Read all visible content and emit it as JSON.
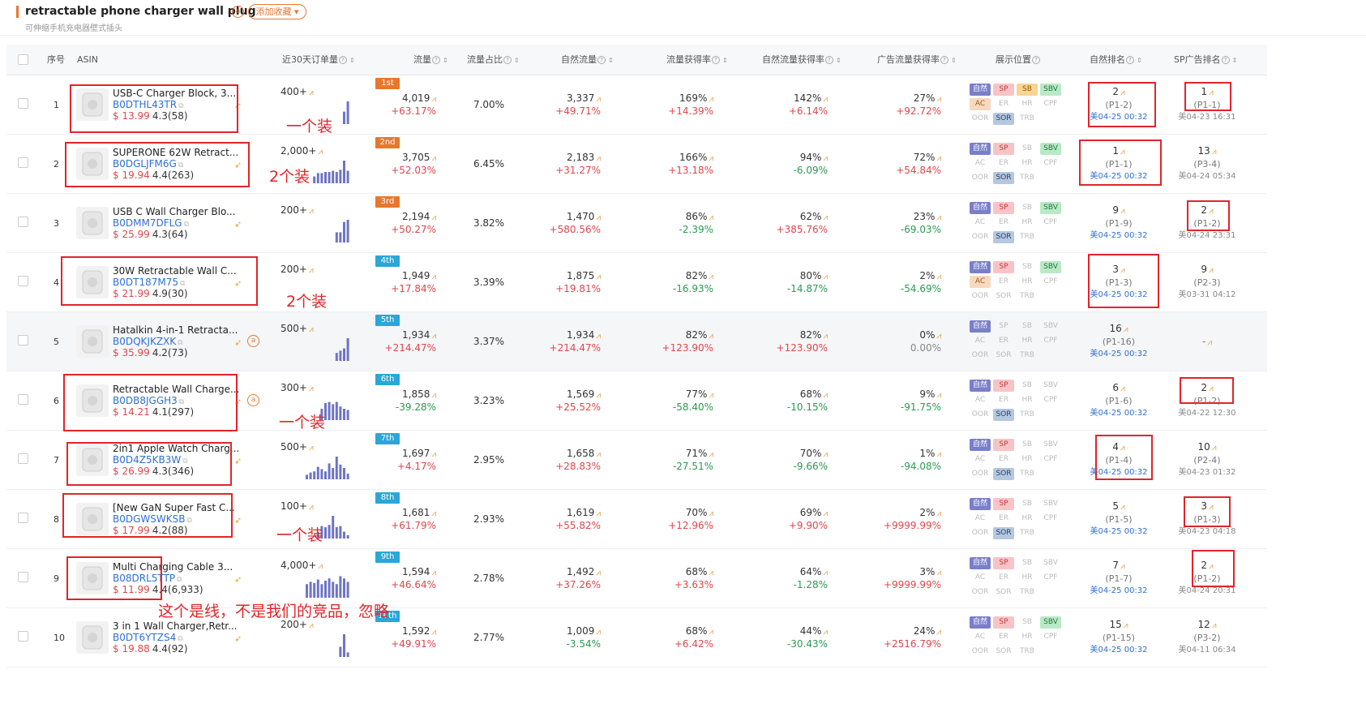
{
  "header": {
    "keyword": "retractable phone charger wall plug",
    "badge": "a",
    "add_favorite": "添加收藏 ▾",
    "translation": "可伸缩手机充电器壁式插头"
  },
  "columns": {
    "index": "序号",
    "asin": "ASIN",
    "sales30": "近30天订单量",
    "traffic": "流量",
    "traffic_share": "流量占比",
    "organic_traffic": "自然流量",
    "traffic_capture": "流量获得率",
    "organic_capture": "自然流量获得率",
    "ad_capture": "广告流量获得率",
    "placement": "展示位置",
    "organic_rank": "自然排名",
    "sp_rank": "SP广告排名"
  },
  "tag_labels": [
    "自然",
    "SP",
    "SB",
    "SBV",
    "AC",
    "ER",
    "HR",
    "CPF",
    "OOR",
    "SOR",
    "TRB"
  ],
  "colors": {
    "accent": "#e8772e",
    "red": "#e2242a",
    "up": "#e0464b",
    "down": "#2a9a52",
    "link": "#2f6fd6",
    "spark": "#6e74c4"
  },
  "rows": [
    {
      "idx": "1",
      "title": "USB-C Charger Block, 3...",
      "asin": "B0DTHL43TR",
      "price": "$ 13.99",
      "rating": "4.3(58)",
      "sales": "400+",
      "rank_badge": "1st",
      "rank_color": "#e8772e",
      "traffic": "4,019",
      "traffic_g": "+63.17%",
      "share": "7.00%",
      "organic": "3,337",
      "organic_g": "+49.71%",
      "cap": "169%",
      "cap_g": "+14.39%",
      "ocap": "142%",
      "ocap_g": "+6.14%",
      "acap": "27%",
      "acap_g": "+92.72%",
      "tags": [
        "natural",
        "sp",
        "sb",
        "sbv",
        "ac",
        "",
        "",
        "",
        "",
        "sor",
        ""
      ],
      "nat_rank": "2",
      "nat_pos": "(P1-2)",
      "nat_time": "美04-25 00:32",
      "sp_rank": "1",
      "sp_pos": "(P1-1)",
      "sp_time": "美04-23 16:31",
      "has_a": false,
      "spark": [
        0,
        0,
        0,
        0,
        0,
        0,
        0,
        0,
        0,
        0,
        0.55,
        1.0
      ]
    },
    {
      "idx": "2",
      "title": "SUPERONE 62W Retract...",
      "asin": "B0DGLJFM6G",
      "price": "$ 19.94",
      "rating": "4.4(263)",
      "sales": "2,000+",
      "rank_badge": "2nd",
      "rank_color": "#e8772e",
      "traffic": "3,705",
      "traffic_g": "+52.03%",
      "share": "6.45%",
      "organic": "2,183",
      "organic_g": "+31.27%",
      "cap": "166%",
      "cap_g": "+13.18%",
      "ocap": "94%",
      "ocap_g": "-6.09%",
      "acap": "72%",
      "acap_g": "+54.84%",
      "tags": [
        "natural",
        "sp",
        "",
        "sbv",
        "",
        "",
        "",
        "",
        "",
        "sor",
        ""
      ],
      "nat_rank": "1",
      "nat_pos": "(P1-1)",
      "nat_time": "美04-25 00:32",
      "sp_rank": "13",
      "sp_pos": "(P3-4)",
      "sp_time": "美04-24 05:34",
      "has_a": false,
      "spark": [
        0,
        0,
        0.3,
        0.45,
        0.45,
        0.5,
        0.5,
        0.55,
        0.5,
        0.6,
        1.0,
        0.55
      ]
    },
    {
      "idx": "3",
      "title": "USB C Wall Charger Blo...",
      "asin": "B0DMM7DFLG",
      "price": "$ 25.99",
      "rating": "4.3(64)",
      "sales": "200+",
      "rank_badge": "3rd",
      "rank_color": "#e8772e",
      "traffic": "2,194",
      "traffic_g": "+50.27%",
      "share": "3.82%",
      "organic": "1,470",
      "organic_g": "+580.56%",
      "cap": "86%",
      "cap_g": "-2.39%",
      "ocap": "62%",
      "ocap_g": "+385.76%",
      "acap": "23%",
      "acap_g": "-69.03%",
      "tags": [
        "natural",
        "sp",
        "",
        "sbv",
        "",
        "",
        "",
        "",
        "",
        "sor",
        ""
      ],
      "nat_rank": "9",
      "nat_pos": "(P1-9)",
      "nat_time": "美04-25 00:32",
      "sp_rank": "2",
      "sp_pos": "(P1-2)",
      "sp_time": "美04-24 23:31",
      "has_a": false,
      "spark": [
        0,
        0,
        0,
        0,
        0,
        0,
        0,
        0,
        0.45,
        0.45,
        0.9,
        1.0
      ]
    },
    {
      "idx": "4",
      "title": "30W Retractable Wall C...",
      "asin": "B0DT187M75",
      "price": "$ 21.99",
      "rating": "4.9(30)",
      "sales": "200+",
      "rank_badge": "4th",
      "rank_color": "#2aa7d8",
      "traffic": "1,949",
      "traffic_g": "+17.84%",
      "share": "3.39%",
      "organic": "1,875",
      "organic_g": "+19.81%",
      "cap": "82%",
      "cap_g": "-16.93%",
      "ocap": "80%",
      "ocap_g": "-14.87%",
      "acap": "2%",
      "acap_g": "-54.69%",
      "tags": [
        "natural",
        "sp",
        "",
        "sbv",
        "ac",
        "",
        "",
        "",
        "",
        "",
        ""
      ],
      "nat_rank": "3",
      "nat_pos": "(P1-3)",
      "nat_time": "美04-25 00:32",
      "sp_rank": "9",
      "sp_pos": "(P2-3)",
      "sp_time": "美03-31 04:12",
      "has_a": false,
      "spark": []
    },
    {
      "idx": "5",
      "title": "Hatalkin 4-in-1 Retracta...",
      "asin": "B0DQKJKZXK",
      "price": "$ 35.99",
      "rating": "4.2(73)",
      "sales": "500+",
      "rank_badge": "5th",
      "rank_color": "#2aa7d8",
      "traffic": "1,934",
      "traffic_g": "+214.47%",
      "share": "3.37%",
      "organic": "1,934",
      "organic_g": "+214.47%",
      "cap": "82%",
      "cap_g": "+123.90%",
      "ocap": "82%",
      "ocap_g": "+123.90%",
      "acap": "0%",
      "acap_g": "0.00%",
      "tags": [
        "natural",
        "",
        "",
        "",
        "",
        "",
        "",
        "",
        "",
        "",
        ""
      ],
      "nat_rank": "16",
      "nat_pos": "(P1-16)",
      "nat_time": "美04-25 00:32",
      "sp_rank": "-",
      "sp_pos": "",
      "sp_time": "",
      "has_a": true,
      "spark": [
        0,
        0,
        0,
        0,
        0,
        0,
        0,
        0,
        0.35,
        0.45,
        0.55,
        1.0
      ]
    },
    {
      "idx": "6",
      "title": "Retractable Wall Charge...",
      "asin": "B0DB8JGGH3",
      "price": "$ 14.21",
      "rating": "4.1(297)",
      "sales": "300+",
      "rank_badge": "6th",
      "rank_color": "#2aa7d8",
      "traffic": "1,858",
      "traffic_g": "-39.28%",
      "share": "3.23%",
      "organic": "1,569",
      "organic_g": "+25.52%",
      "cap": "77%",
      "cap_g": "-58.40%",
      "ocap": "68%",
      "ocap_g": "-10.15%",
      "acap": "9%",
      "acap_g": "-91.75%",
      "tags": [
        "natural",
        "sp",
        "",
        "",
        "",
        "",
        "",
        "",
        "",
        "sor",
        ""
      ],
      "nat_rank": "6",
      "nat_pos": "(P1-6)",
      "nat_time": "美04-25 00:32",
      "sp_rank": "2",
      "sp_pos": "(P1-2)",
      "sp_time": "美04-22 12:30",
      "has_a": true,
      "spark": [
        0,
        0,
        0,
        0,
        0.5,
        0.75,
        0.8,
        0.7,
        0.8,
        0.6,
        0.5,
        0.45
      ]
    },
    {
      "idx": "7",
      "title": "2in1 Apple Watch Charg...",
      "asin": "B0D4Z5KB3W",
      "price": "$ 26.99",
      "rating": "4.3(346)",
      "sales": "500+",
      "rank_badge": "7th",
      "rank_color": "#2aa7d8",
      "traffic": "1,697",
      "traffic_g": "+4.17%",
      "share": "2.95%",
      "organic": "1,658",
      "organic_g": "+28.83%",
      "cap": "71%",
      "cap_g": "-27.51%",
      "ocap": "70%",
      "ocap_g": "-9.66%",
      "acap": "1%",
      "acap_g": "-94.08%",
      "tags": [
        "natural",
        "sp",
        "",
        "",
        "",
        "",
        "",
        "",
        "",
        "sor",
        ""
      ],
      "nat_rank": "4",
      "nat_pos": "(P1-4)",
      "nat_time": "美04-25 00:32",
      "sp_rank": "10",
      "sp_pos": "(P2-4)",
      "sp_time": "美04-23 01:32",
      "has_a": false,
      "spark": [
        0.2,
        0.3,
        0.35,
        0.55,
        0.45,
        0.35,
        0.7,
        0.5,
        1.0,
        0.65,
        0.5,
        0.25
      ]
    },
    {
      "idx": "8",
      "title": "[New GaN Super Fast C...",
      "asin": "B0DGWSWKSB",
      "price": "$ 17.99",
      "rating": "4.2(88)",
      "sales": "100+",
      "rank_badge": "8th",
      "rank_color": "#2aa7d8",
      "traffic": "1,681",
      "traffic_g": "+61.79%",
      "share": "2.93%",
      "organic": "1,619",
      "organic_g": "+55.82%",
      "cap": "70%",
      "cap_g": "+12.96%",
      "ocap": "69%",
      "ocap_g": "+9.90%",
      "acap": "2%",
      "acap_g": "+9999.99%",
      "tags": [
        "natural",
        "sp",
        "",
        "",
        "",
        "",
        "",
        "",
        "",
        "sor",
        ""
      ],
      "nat_rank": "5",
      "nat_pos": "(P1-5)",
      "nat_time": "美04-25 00:32",
      "sp_rank": "3",
      "sp_pos": "(P1-3)",
      "sp_time": "美04-23 04:18",
      "has_a": false,
      "spark": [
        0,
        0,
        0,
        0.3,
        0.55,
        0.5,
        0.6,
        1.0,
        0.5,
        0.55,
        0.3,
        0.15
      ]
    },
    {
      "idx": "9",
      "title": "Multi Charging Cable 3...",
      "asin": "B08DRL5TTP",
      "price": "$ 11.99",
      "rating": "4.4(6,933)",
      "sales": "4,000+",
      "rank_badge": "9th",
      "rank_color": "#2aa7d8",
      "traffic": "1,594",
      "traffic_g": "+46.64%",
      "share": "2.78%",
      "organic": "1,492",
      "organic_g": "+37.26%",
      "cap": "68%",
      "cap_g": "+3.63%",
      "ocap": "64%",
      "ocap_g": "-1.28%",
      "acap": "3%",
      "acap_g": "+9999.99%",
      "tags": [
        "natural",
        "sp",
        "",
        "",
        "",
        "",
        "",
        "",
        "",
        "",
        ""
      ],
      "nat_rank": "7",
      "nat_pos": "(P1-7)",
      "nat_time": "美04-25 00:32",
      "sp_rank": "2",
      "sp_pos": "(P1-2)",
      "sp_time": "美04-24 20:31",
      "has_a": false,
      "spark": [
        0.6,
        0.7,
        0.65,
        0.8,
        0.6,
        0.75,
        0.85,
        0.7,
        0.6,
        0.95,
        0.85,
        0.7
      ]
    },
    {
      "idx": "10",
      "title": "3 in 1 Wall Charger,Retr...",
      "asin": "B0DT6YTZS4",
      "price": "$ 19.88",
      "rating": "4.4(92)",
      "sales": "200+",
      "rank_badge": "10th",
      "rank_color": "#2aa7d8",
      "traffic": "1,592",
      "traffic_g": "+49.91%",
      "share": "2.77%",
      "organic": "1,009",
      "organic_g": "-3.54%",
      "cap": "68%",
      "cap_g": "+6.42%",
      "ocap": "44%",
      "ocap_g": "-30.43%",
      "acap": "24%",
      "acap_g": "+2516.79%",
      "tags": [
        "natural",
        "sp",
        "",
        "sbv",
        "",
        "",
        "",
        "",
        "",
        "",
        ""
      ],
      "nat_rank": "15",
      "nat_pos": "(P1-15)",
      "nat_time": "美04-25 00:32",
      "sp_rank": "12",
      "sp_pos": "(P3-2)",
      "sp_time": "美04-11 06:34",
      "has_a": false,
      "spark": [
        0,
        0,
        0,
        0,
        0,
        0,
        0,
        0,
        0,
        0.45,
        1.0,
        0.2
      ]
    }
  ],
  "annotations": [
    "一个装",
    "2个装",
    "2个装",
    "一个装",
    "一个装",
    "这个是线，不是我们的竞品，忽略"
  ]
}
